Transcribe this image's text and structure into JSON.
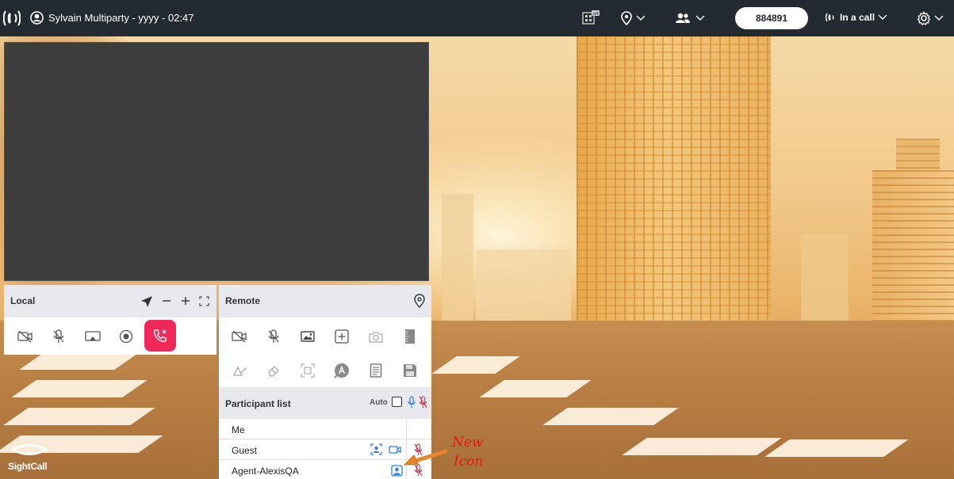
{
  "topbar": {
    "title": "Sylvain Multiparty - yyyy - 02:47",
    "session_code": "884891",
    "call_status": "In a call",
    "icons": [
      "phone-logo-icon",
      "user-circle-icon",
      "qr-off-icon",
      "location-pin-icon",
      "participants-icon",
      "phone-call-icon",
      "gear-icon"
    ]
  },
  "local_panel": {
    "title": "Local",
    "controls": [
      "camera-off-icon",
      "mic-off-icon",
      "screen-share-icon",
      "record-icon",
      "hangup-icon"
    ]
  },
  "remote_panel": {
    "title": "Remote",
    "controls_row1": [
      "camera-off-icon",
      "mic-off-icon",
      "gallery-icon",
      "add-box-icon",
      "camera-snapshot-icon",
      "ruler-icon"
    ],
    "controls_row2": [
      "draw-icon",
      "eraser-icon",
      "scan-icon",
      "text-annotate-icon",
      "notes-icon",
      "save-icon"
    ]
  },
  "participant_list": {
    "title": "Participant list",
    "auto_label": "Auto",
    "auto_checked": false,
    "participants": [
      {
        "name": "Me"
      },
      {
        "name": "Guest"
      },
      {
        "name": "Agent-AlexisQA"
      }
    ]
  },
  "annotation": {
    "line1": "New",
    "line2": "Icon"
  },
  "brand": "SightCall",
  "colors": {
    "topbar": "#242a31",
    "hangup": "#f0285a",
    "accent_blue": "#2b7de9",
    "mute_red": "#e0324f"
  }
}
